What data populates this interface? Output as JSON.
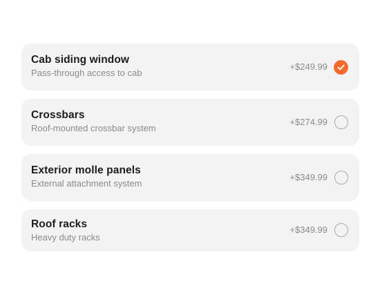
{
  "accent_color": "#f26a2e",
  "options": [
    {
      "title": "Cab siding window",
      "subtitle": "Pass-through access to cab",
      "price": "+$249.99",
      "selected": true
    },
    {
      "title": "Crossbars",
      "subtitle": "Roof-mounted crossbar system",
      "price": "+$274.99",
      "selected": false
    },
    {
      "title": "Exterior molle panels",
      "subtitle": "External attachment system",
      "price": "+$349.99",
      "selected": false
    },
    {
      "title": "Roof racks",
      "subtitle": "Heavy duty racks",
      "price": "+$349.99",
      "selected": false
    }
  ],
  "icons": {
    "selected": "checkmark-icon",
    "unselected": "empty-radio-icon"
  }
}
